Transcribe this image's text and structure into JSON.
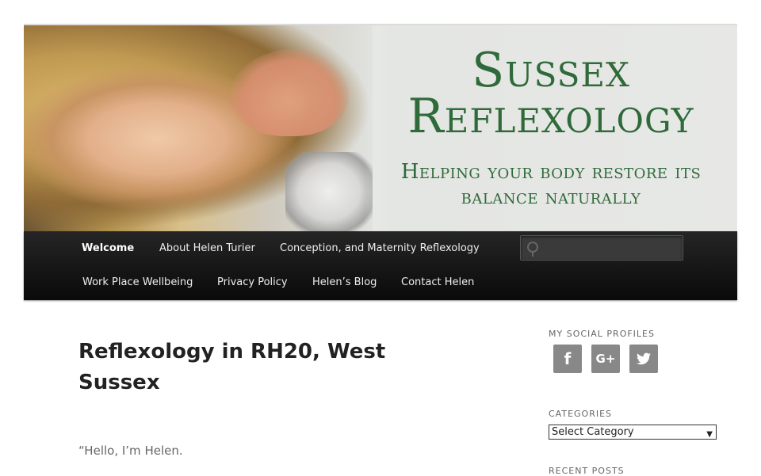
{
  "header": {
    "title_line1": "Sussex",
    "title_line2": "Reflexology",
    "tagline_line1": "Helping your body restore its",
    "tagline_line2": "balance naturally"
  },
  "nav": {
    "items": [
      {
        "label": "Welcome",
        "current": true
      },
      {
        "label": "About Helen Turier"
      },
      {
        "label": "Conception, and Maternity Reflexology"
      },
      {
        "label": "Work Place Wellbeing"
      },
      {
        "label": "Privacy Policy"
      },
      {
        "label": "Helen’s Blog"
      },
      {
        "label": "Contact Helen"
      }
    ],
    "search_value": ""
  },
  "main": {
    "title": "Reflexology in RH20, West Sussex",
    "intro": "“Hello, I’m Helen."
  },
  "sidebar": {
    "social_title": "MY SOCIAL PROFILES",
    "social": [
      {
        "icon": "facebook-icon",
        "glyph": "f"
      },
      {
        "icon": "google-plus-icon",
        "glyph": "G+"
      },
      {
        "icon": "twitter-icon",
        "glyph": "🐦"
      }
    ],
    "categories_title": "CATEGORIES",
    "categories_selected": "Select Category",
    "recent_title": "RECENT POSTS"
  },
  "colors": {
    "brand_green": "#2f6a3a",
    "nav_bg": "#111111",
    "social_bg": "#888888"
  }
}
